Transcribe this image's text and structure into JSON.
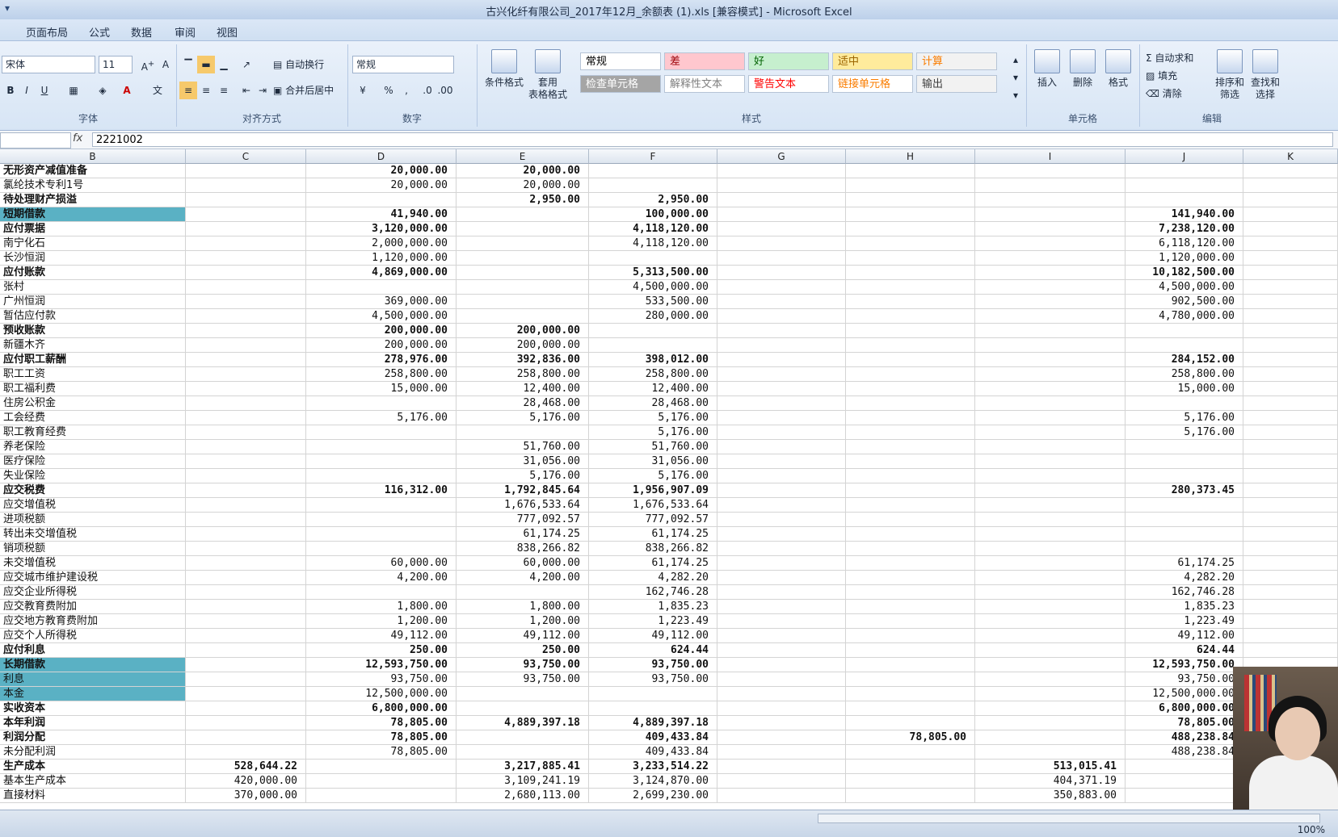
{
  "window": {
    "title": "古兴化纤有限公司_2017年12月_余额表 (1).xls [兼容模式] - Microsoft Excel"
  },
  "menu": {
    "tabs": [
      "页面布局",
      "公式",
      "数据",
      "审阅",
      "视图"
    ]
  },
  "ribbon": {
    "font": {
      "name": "宋体",
      "size": "11",
      "label": "字体"
    },
    "align": {
      "label": "对齐方式",
      "wrap": "自动换行",
      "merge": "合并后居中"
    },
    "number": {
      "format": "常规",
      "label": "数字"
    },
    "styles": {
      "label": "样式",
      "cond_format": "条件格式",
      "table_format": "套用\n表格格式",
      "cells": [
        {
          "text": "常规",
          "bg": "#ffffff",
          "fg": "#000000"
        },
        {
          "text": "差",
          "bg": "#ffc7ce",
          "fg": "#9c0006"
        },
        {
          "text": "好",
          "bg": "#c6efce",
          "fg": "#006100"
        },
        {
          "text": "适中",
          "bg": "#ffeb9c",
          "fg": "#9c6500"
        },
        {
          "text": "计算",
          "bg": "#f2f2f2",
          "fg": "#fa7d00"
        },
        {
          "text": "检查单元格",
          "bg": "#a5a5a5",
          "fg": "#ffffff"
        },
        {
          "text": "解释性文本",
          "bg": "#ffffff",
          "fg": "#7f7f7f"
        },
        {
          "text": "警告文本",
          "bg": "#ffffff",
          "fg": "#ff0000"
        },
        {
          "text": "链接单元格",
          "bg": "#ffffff",
          "fg": "#fa7d00"
        },
        {
          "text": "输出",
          "bg": "#f2f2f2",
          "fg": "#3f3f3f"
        }
      ]
    },
    "cells": {
      "label": "单元格",
      "insert": "插入",
      "delete": "删除",
      "format": "格式"
    },
    "edit": {
      "label": "编辑",
      "autosum": "Σ 自动求和",
      "fill": "填充",
      "clear": "清除",
      "sort": "排序和\n筛选",
      "find": "查找和\n选择"
    }
  },
  "formula": {
    "value": "2221002"
  },
  "columns": [
    "B",
    "C",
    "D",
    "E",
    "F",
    "G",
    "H",
    "I",
    "J",
    "K"
  ],
  "rows": [
    {
      "b": "无形资产减值准备",
      "c": "",
      "d": "20,000.00",
      "e": "20,000.00",
      "f": "",
      "h": "",
      "i": "",
      "j": "",
      "bold": true
    },
    {
      "b": "氯纶技术专利1号",
      "c": "",
      "d": "20,000.00",
      "e": "20,000.00",
      "f": "",
      "h": "",
      "i": "",
      "j": "",
      "bold": false
    },
    {
      "b": "待处理财产损溢",
      "c": "",
      "d": "",
      "e": "2,950.00",
      "f": "2,950.00",
      "h": "",
      "i": "",
      "j": "",
      "bold": true
    },
    {
      "b": "短期借款",
      "c": "",
      "d": "41,940.00",
      "e": "",
      "f": "100,000.00",
      "h": "",
      "i": "",
      "j": "141,940.00",
      "bold": true,
      "hl": true
    },
    {
      "b": "应付票据",
      "c": "",
      "d": "3,120,000.00",
      "e": "",
      "f": "4,118,120.00",
      "h": "",
      "i": "",
      "j": "7,238,120.00",
      "bold": true
    },
    {
      "b": "南宁化石",
      "c": "",
      "d": "2,000,000.00",
      "e": "",
      "f": "4,118,120.00",
      "h": "",
      "i": "",
      "j": "6,118,120.00",
      "bold": false
    },
    {
      "b": "长沙恒润",
      "c": "",
      "d": "1,120,000.00",
      "e": "",
      "f": "",
      "h": "",
      "i": "",
      "j": "1,120,000.00",
      "bold": false
    },
    {
      "b": "应付账款",
      "c": "",
      "d": "4,869,000.00",
      "e": "",
      "f": "5,313,500.00",
      "h": "",
      "i": "",
      "j": "10,182,500.00",
      "bold": true
    },
    {
      "b": "张村",
      "c": "",
      "d": "",
      "e": "",
      "f": "4,500,000.00",
      "h": "",
      "i": "",
      "j": "4,500,000.00",
      "bold": false
    },
    {
      "b": "广州恒润",
      "c": "",
      "d": "369,000.00",
      "e": "",
      "f": "533,500.00",
      "h": "",
      "i": "",
      "j": "902,500.00",
      "bold": false
    },
    {
      "b": "暂估应付款",
      "c": "",
      "d": "4,500,000.00",
      "e": "",
      "f": "280,000.00",
      "h": "",
      "i": "",
      "j": "4,780,000.00",
      "bold": false
    },
    {
      "b": "预收账款",
      "c": "",
      "d": "200,000.00",
      "e": "200,000.00",
      "f": "",
      "h": "",
      "i": "",
      "j": "",
      "bold": true
    },
    {
      "b": "新疆木齐",
      "c": "",
      "d": "200,000.00",
      "e": "200,000.00",
      "f": "",
      "h": "",
      "i": "",
      "j": "",
      "bold": false
    },
    {
      "b": "应付职工薪酬",
      "c": "",
      "d": "278,976.00",
      "e": "392,836.00",
      "f": "398,012.00",
      "h": "",
      "i": "",
      "j": "284,152.00",
      "bold": true
    },
    {
      "b": "职工工资",
      "c": "",
      "d": "258,800.00",
      "e": "258,800.00",
      "f": "258,800.00",
      "h": "",
      "i": "",
      "j": "258,800.00",
      "bold": false
    },
    {
      "b": "职工福利费",
      "c": "",
      "d": "15,000.00",
      "e": "12,400.00",
      "f": "12,400.00",
      "h": "",
      "i": "",
      "j": "15,000.00",
      "bold": false
    },
    {
      "b": "住房公积金",
      "c": "",
      "d": "",
      "e": "28,468.00",
      "f": "28,468.00",
      "h": "",
      "i": "",
      "j": "",
      "bold": false
    },
    {
      "b": "工会经费",
      "c": "",
      "d": "5,176.00",
      "e": "5,176.00",
      "f": "5,176.00",
      "h": "",
      "i": "",
      "j": "5,176.00",
      "bold": false
    },
    {
      "b": "职工教育经费",
      "c": "",
      "d": "",
      "e": "",
      "f": "5,176.00",
      "h": "",
      "i": "",
      "j": "5,176.00",
      "bold": false
    },
    {
      "b": "养老保险",
      "c": "",
      "d": "",
      "e": "51,760.00",
      "f": "51,760.00",
      "h": "",
      "i": "",
      "j": "",
      "bold": false
    },
    {
      "b": "医疗保险",
      "c": "",
      "d": "",
      "e": "31,056.00",
      "f": "31,056.00",
      "h": "",
      "i": "",
      "j": "",
      "bold": false
    },
    {
      "b": "失业保险",
      "c": "",
      "d": "",
      "e": "5,176.00",
      "f": "5,176.00",
      "h": "",
      "i": "",
      "j": "",
      "bold": false
    },
    {
      "b": "应交税费",
      "c": "",
      "d": "116,312.00",
      "e": "1,792,845.64",
      "f": "1,956,907.09",
      "h": "",
      "i": "",
      "j": "280,373.45",
      "bold": true
    },
    {
      "b": "应交增值税",
      "c": "",
      "d": "",
      "e": "1,676,533.64",
      "f": "1,676,533.64",
      "h": "",
      "i": "",
      "j": "",
      "bold": false
    },
    {
      "b": "进项税额",
      "c": "",
      "d": "",
      "e": "777,092.57",
      "f": "777,092.57",
      "h": "",
      "i": "",
      "j": "",
      "bold": false
    },
    {
      "b": "转出未交增值税",
      "c": "",
      "d": "",
      "e": "61,174.25",
      "f": "61,174.25",
      "h": "",
      "i": "",
      "j": "",
      "bold": false
    },
    {
      "b": "销项税额",
      "c": "",
      "d": "",
      "e": "838,266.82",
      "f": "838,266.82",
      "h": "",
      "i": "",
      "j": "",
      "bold": false
    },
    {
      "b": "未交增值税",
      "c": "",
      "d": "60,000.00",
      "e": "60,000.00",
      "f": "61,174.25",
      "h": "",
      "i": "",
      "j": "61,174.25",
      "bold": false
    },
    {
      "b": "应交城市维护建设税",
      "c": "",
      "d": "4,200.00",
      "e": "4,200.00",
      "f": "4,282.20",
      "h": "",
      "i": "",
      "j": "4,282.20",
      "bold": false
    },
    {
      "b": "应交企业所得税",
      "c": "",
      "d": "",
      "e": "",
      "f": "162,746.28",
      "h": "",
      "i": "",
      "j": "162,746.28",
      "bold": false
    },
    {
      "b": "应交教育费附加",
      "c": "",
      "d": "1,800.00",
      "e": "1,800.00",
      "f": "1,835.23",
      "h": "",
      "i": "",
      "j": "1,835.23",
      "bold": false
    },
    {
      "b": "应交地方教育费附加",
      "c": "",
      "d": "1,200.00",
      "e": "1,200.00",
      "f": "1,223.49",
      "h": "",
      "i": "",
      "j": "1,223.49",
      "bold": false
    },
    {
      "b": "应交个人所得税",
      "c": "",
      "d": "49,112.00",
      "e": "49,112.00",
      "f": "49,112.00",
      "h": "",
      "i": "",
      "j": "49,112.00",
      "bold": false
    },
    {
      "b": "应付利息",
      "c": "",
      "d": "250.00",
      "e": "250.00",
      "f": "624.44",
      "h": "",
      "i": "",
      "j": "624.44",
      "bold": true
    },
    {
      "b": "长期借款",
      "c": "",
      "d": "12,593,750.00",
      "e": "93,750.00",
      "f": "93,750.00",
      "h": "",
      "i": "",
      "j": "12,593,750.00",
      "bold": true,
      "hl": true
    },
    {
      "b": "利息",
      "c": "",
      "d": "93,750.00",
      "e": "93,750.00",
      "f": "93,750.00",
      "h": "",
      "i": "",
      "j": "93,750.00",
      "bold": false,
      "hl": true
    },
    {
      "b": "本金",
      "c": "",
      "d": "12,500,000.00",
      "e": "",
      "f": "",
      "h": "",
      "i": "",
      "j": "12,500,000.00",
      "bold": false,
      "hl": true
    },
    {
      "b": "实收资本",
      "c": "",
      "d": "6,800,000.00",
      "e": "",
      "f": "",
      "h": "",
      "i": "",
      "j": "6,800,000.00",
      "bold": true
    },
    {
      "b": "本年利润",
      "c": "",
      "d": "78,805.00",
      "e": "4,889,397.18",
      "f": "4,889,397.18",
      "h": "",
      "i": "",
      "j": "78,805.00",
      "bold": true
    },
    {
      "b": "利润分配",
      "c": "",
      "d": "78,805.00",
      "e": "",
      "f": "409,433.84",
      "h": "78,805.00",
      "i": "",
      "j": "488,238.84",
      "bold": true
    },
    {
      "b": "未分配利润",
      "c": "",
      "d": "78,805.00",
      "e": "",
      "f": "409,433.84",
      "h": "",
      "i": "",
      "j": "488,238.84",
      "bold": false
    },
    {
      "b": "生产成本",
      "c": "528,644.22",
      "d": "",
      "e": "3,217,885.41",
      "f": "3,233,514.22",
      "h": "",
      "i": "513,015.41",
      "j": "",
      "bold": true
    },
    {
      "b": "基本生产成本",
      "c": "420,000.00",
      "d": "",
      "e": "3,109,241.19",
      "f": "3,124,870.00",
      "h": "",
      "i": "404,371.19",
      "j": "",
      "bold": false
    },
    {
      "b": "直接材料",
      "c": "370,000.00",
      "d": "",
      "e": "2,680,113.00",
      "f": "2,699,230.00",
      "h": "",
      "i": "350,883.00",
      "j": "",
      "bold": false
    }
  ],
  "status": {
    "zoom": "100%"
  }
}
